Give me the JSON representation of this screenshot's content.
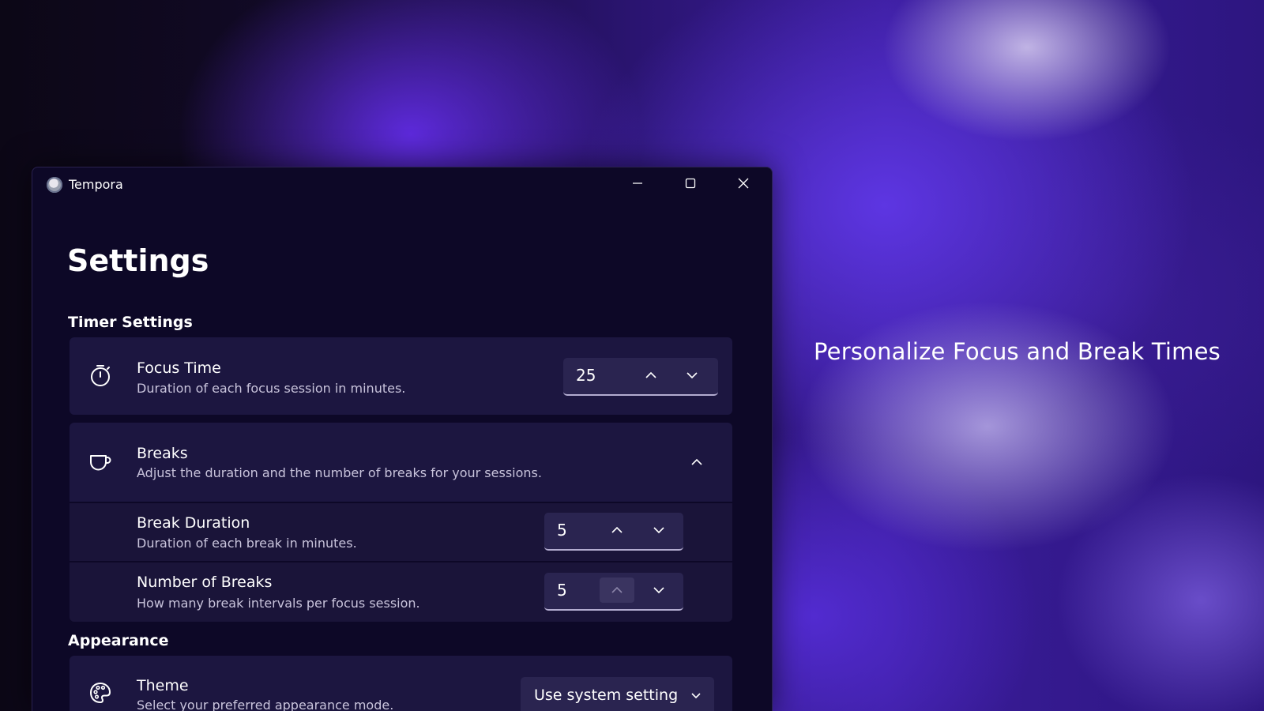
{
  "tagline": "Personalize Focus and Break Times",
  "window": {
    "title": "Tempora",
    "controls": [
      "minimize-icon",
      "maximize-icon",
      "close-icon"
    ]
  },
  "page": {
    "title": "Settings"
  },
  "sections": {
    "timer": {
      "title": "Timer Settings",
      "focus_time": {
        "icon": "stopwatch-icon",
        "title": "Focus Time",
        "description": "Duration of each focus session in minutes.",
        "value": "25"
      },
      "breaks": {
        "icon": "cup-icon",
        "title": "Breaks",
        "description": "Adjust the duration and the number of breaks for your sessions.",
        "expanded": true,
        "break_duration": {
          "title": "Break Duration",
          "description": "Duration of each break in minutes.",
          "value": "5"
        },
        "number_of_breaks": {
          "title": "Number of Breaks",
          "description": "How many break intervals per focus session.",
          "value": "5"
        }
      }
    },
    "appearance": {
      "title": "Appearance",
      "theme": {
        "icon": "palette-icon",
        "title": "Theme",
        "description": "Select your preferred appearance mode.",
        "selected": "Use system setting"
      }
    }
  },
  "colors": {
    "window_bg": "#0d0827",
    "card_bg": "#1c1640",
    "control_bg": "#2a2450",
    "accent_purple": "#5b32e0"
  }
}
